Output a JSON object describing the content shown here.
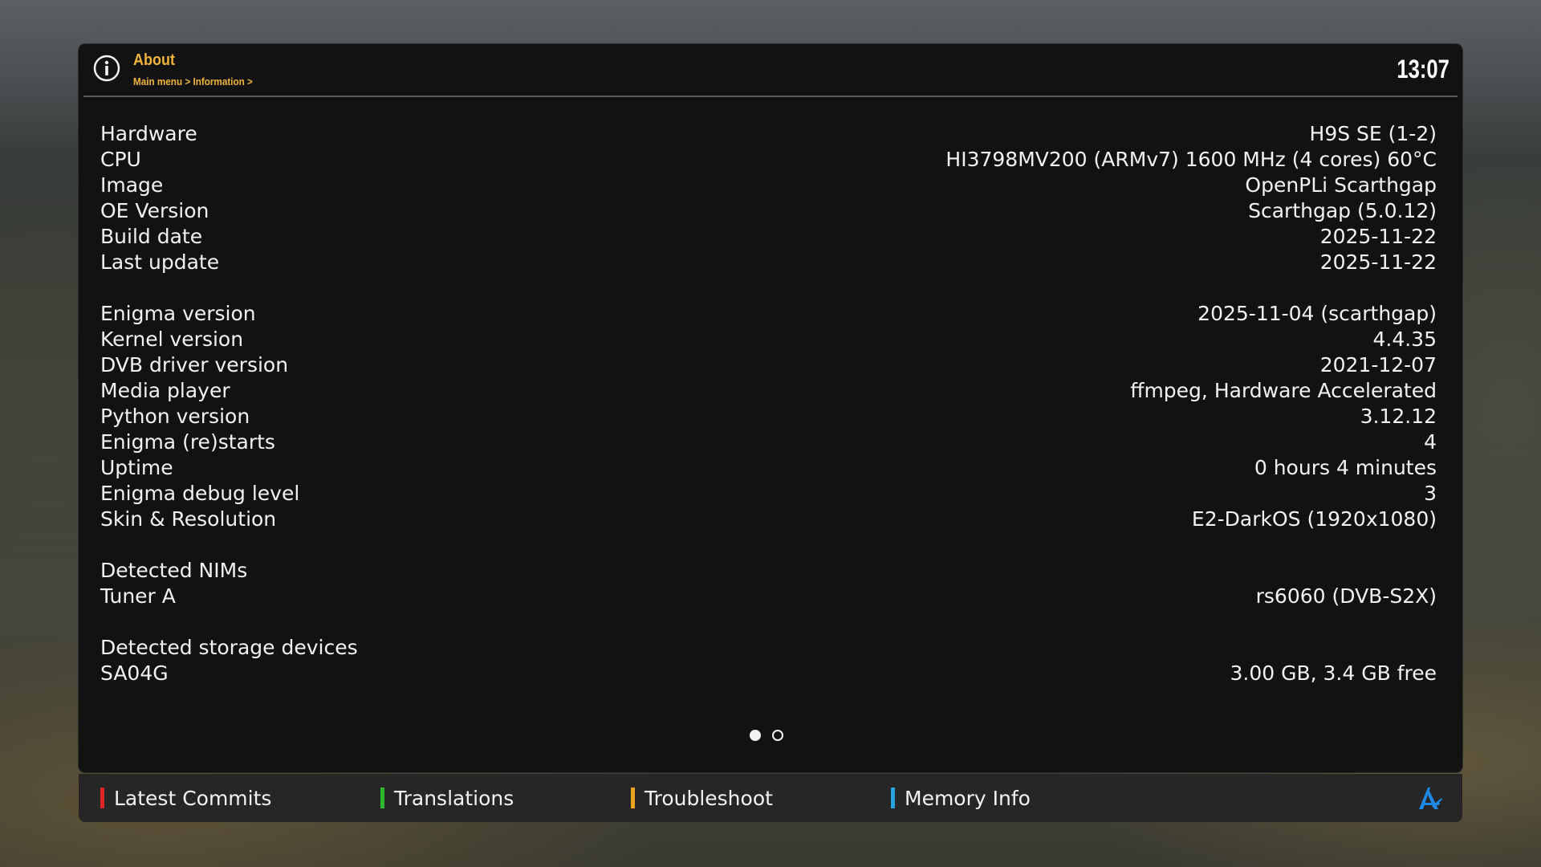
{
  "header": {
    "title": "About",
    "breadcrumb": "Main menu > Information >",
    "clock": "13:07"
  },
  "sections": [
    [
      {
        "label": "Hardware",
        "value": "H9S SE (1-2)"
      },
      {
        "label": "CPU",
        "value": "HI3798MV200 (ARMv7) 1600 MHz (4 cores) 60°C"
      },
      {
        "label": "Image",
        "value": "OpenPLi Scarthgap"
      },
      {
        "label": "OE Version",
        "value": "Scarthgap (5.0.12)"
      },
      {
        "label": "Build date",
        "value": "2025-11-22"
      },
      {
        "label": "Last update",
        "value": "2025-11-22"
      }
    ],
    [
      {
        "label": "Enigma version",
        "value": "2025-11-04 (scarthgap)"
      },
      {
        "label": "Kernel version",
        "value": "4.4.35"
      },
      {
        "label": "DVB driver version",
        "value": "2021-12-07"
      },
      {
        "label": "Media player",
        "value": "ffmpeg, Hardware Accelerated"
      },
      {
        "label": "Python version",
        "value": "3.12.12"
      },
      {
        "label": "Enigma (re)starts",
        "value": "4"
      },
      {
        "label": "Uptime",
        "value": "0 hours 4 minutes"
      },
      {
        "label": "Enigma debug level",
        "value": "3"
      },
      {
        "label": "Skin & Resolution",
        "value": "E2-DarkOS (1920x1080)"
      }
    ],
    [
      {
        "label": "Detected NIMs",
        "value": ""
      },
      {
        "label": "Tuner A",
        "value": "rs6060 (DVB-S2X)"
      }
    ],
    [
      {
        "label": "Detected storage devices",
        "value": ""
      },
      {
        "label": "SA04G",
        "value": "3.00 GB, 3.4 GB free"
      }
    ]
  ],
  "pager": {
    "current_page": 1,
    "total_pages": 2
  },
  "footer": {
    "keys": [
      {
        "label": "Latest Commits",
        "color": "#e02424"
      },
      {
        "label": "Translations",
        "color": "#2db82d"
      },
      {
        "label": "Troubleshoot",
        "color": "#f2a31c"
      },
      {
        "label": "Memory Info",
        "color": "#2aa2e0"
      }
    ],
    "logo_icon": "openpli-logo-icon"
  },
  "colors": {
    "accent": "#f0b33c",
    "panel": "#121212",
    "footer": "#262626",
    "logo": "#1e88e5"
  }
}
